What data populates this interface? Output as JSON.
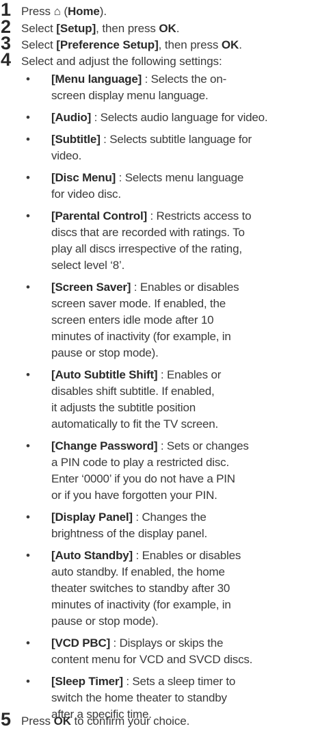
{
  "steps": [
    {
      "num": "1",
      "pre": "Press ",
      "icon": "home-icon",
      "glyph": "⌂",
      "mid": " (",
      "bold": "Home",
      "post": ")."
    },
    {
      "num": "2",
      "pre": "Select ",
      "bold": "[Setup]",
      "mid": ", then press ",
      "bold2": "OK",
      "post": "."
    },
    {
      "num": "3",
      "pre": "Select ",
      "bold": "[Preference Setup]",
      "mid": ", then press ",
      "bold2": "OK",
      "post": "."
    },
    {
      "num": "4",
      "text": "Select and adjust the following settings:"
    },
    {
      "num": "5",
      "pre": "Press ",
      "bold": "OK",
      "post": " to confirm your choice."
    }
  ],
  "settings": [
    {
      "label": "[Menu language]",
      "lines": [
        " : Selects the on-",
        "screen display menu language."
      ]
    },
    {
      "label": "[Audio]",
      "lines": [
        " : Selects audio language for video."
      ]
    },
    {
      "label": "[Subtitle]",
      "lines": [
        " : Selects subtitle language for",
        "video."
      ]
    },
    {
      "label": "[Disc Menu]",
      "lines": [
        " : Selects menu language",
        "for video disc."
      ]
    },
    {
      "label": "[Parental Control]",
      "lines": [
        " : Restricts access to",
        "discs that are recorded with ratings. To",
        "play all discs irrespective of the rating,",
        "select level ‘8’."
      ]
    },
    {
      "label": "[Screen Saver]",
      "lines": [
        " : Enables or disables",
        "screen saver mode. If enabled, the",
        "screen enters idle mode after 10",
        "minutes of inactivity (for example, in",
        "pause or stop mode)."
      ]
    },
    {
      "label": "[Auto Subtitle Shift]",
      "lines": [
        " : Enables or",
        "disables shift subtitle. If enabled,",
        "it adjusts the subtitle position",
        "automatically to fit the TV screen."
      ]
    },
    {
      "label": "[Change Password]",
      "lines": [
        " : Sets or changes",
        "a PIN code to play a restricted disc.",
        "Enter ‘0000’ if you do not have a PIN",
        "or if you have forgotten your PIN."
      ]
    },
    {
      "label": "[Display Panel]",
      "lines": [
        " : Changes the",
        "brightness of the display panel."
      ]
    },
    {
      "label": "[Auto Standby]",
      "lines": [
        " : Enables or disables",
        "auto standby. If enabled, the home",
        "theater switches to standby after 30",
        "minutes of inactivity (for example, in",
        "pause or stop mode)."
      ]
    },
    {
      "label": "[VCD PBC]",
      "lines": [
        " : Displays or skips the",
        "content menu for VCD and SVCD discs."
      ]
    },
    {
      "label": "[Sleep Timer]",
      "lines": [
        " : Sets a sleep timer to",
        "switch the home theater to standby",
        "after a specific time."
      ]
    }
  ],
  "bullet": "•"
}
